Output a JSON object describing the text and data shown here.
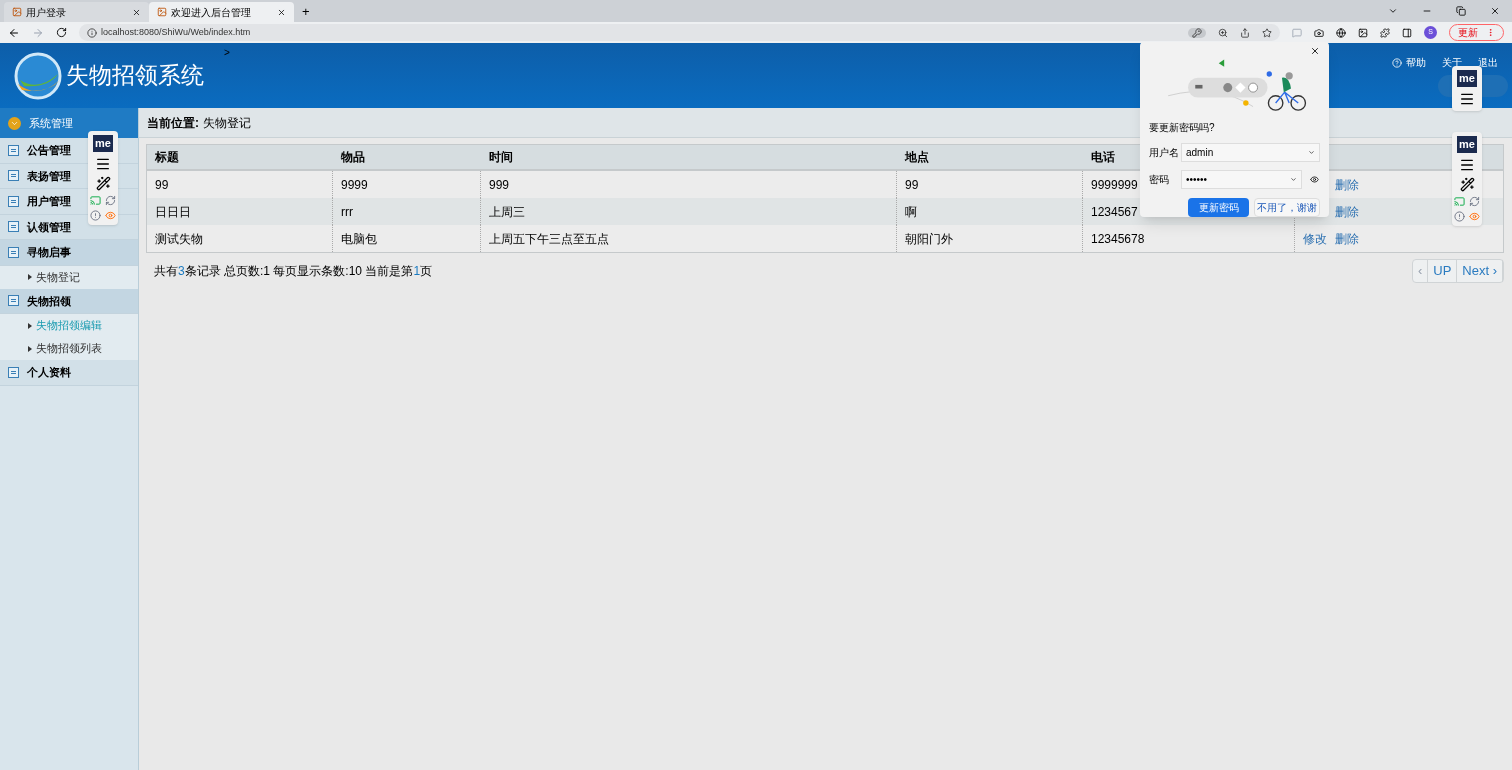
{
  "browser": {
    "tabs": [
      {
        "title": "用户登录",
        "selected": false
      },
      {
        "title": "欢迎进入后台管理",
        "selected": true
      }
    ],
    "new_tab": "+",
    "address": "localhost:8080/ShiWu/Web/index.htm",
    "profile": "S",
    "update_button": "更新"
  },
  "header": {
    "title": "失物招领系统",
    "marker": ">",
    "links": [
      {
        "label": "帮助",
        "kind": "help"
      },
      {
        "label": "关于",
        "kind": "plain"
      },
      {
        "label": "退出",
        "kind": "plain"
      }
    ]
  },
  "sidebar": {
    "heading": "系统管理",
    "items": [
      {
        "label": "公告管理",
        "expanded": false
      },
      {
        "label": "表扬管理",
        "expanded": false
      },
      {
        "label": "用户管理",
        "expanded": false
      },
      {
        "label": "认领管理",
        "expanded": false
      },
      {
        "label": "寻物启事",
        "expanded": true,
        "children": [
          {
            "label": "失物登记",
            "selected": false
          }
        ]
      },
      {
        "label": "失物招领",
        "expanded": true,
        "children": [
          {
            "label": "失物招领编辑",
            "selected": true
          },
          {
            "label": "失物招领列表",
            "selected": false
          }
        ]
      },
      {
        "label": "个人资料",
        "expanded": false
      }
    ]
  },
  "breadcrumb": {
    "label": "当前位置:",
    "value": "失物登记"
  },
  "table": {
    "columns": [
      "标题",
      "物品",
      "时间",
      "地点",
      "电话"
    ],
    "rows": [
      {
        "cells": [
          "99",
          "9999",
          "999",
          "99",
          "9999999"
        ],
        "actions": [
          {
            "label": "删除",
            "kind": "delete"
          }
        ]
      },
      {
        "cells": [
          "日日日",
          "rrr",
          "上周三",
          "啊",
          "1234567"
        ],
        "actions": [
          {
            "label": "删除",
            "kind": "delete"
          }
        ]
      },
      {
        "cells": [
          "测试失物",
          "电脑包",
          "上周五下午三点至五点",
          "朝阳门外",
          "12345678"
        ],
        "actions": [
          {
            "label": "修改",
            "kind": "edit"
          },
          {
            "label": "删除",
            "kind": "delete"
          }
        ]
      }
    ]
  },
  "summary": [
    {
      "text": "共有",
      "highlight": false
    },
    {
      "text": "3",
      "highlight": true
    },
    {
      "text": "条记录 总页数:1 每页显示条数:10 当前是第",
      "highlight": false
    },
    {
      "text": "1",
      "highlight": true
    },
    {
      "text": "页",
      "highlight": false
    }
  ],
  "pager": [
    {
      "label": "‹",
      "disabled": true
    },
    {
      "label": "UP",
      "disabled": false
    },
    {
      "label": "Next ›",
      "disabled": false
    }
  ],
  "password_popup": {
    "title": "要更新密码吗?",
    "username": {
      "label": "用户名",
      "value": "admin"
    },
    "password": {
      "label": "密码",
      "value": "••••••"
    },
    "buttons": [
      {
        "label": "更新密码",
        "kind": "primary"
      },
      {
        "label": "不用了，谢谢",
        "kind": "secondary"
      }
    ]
  },
  "extension_toolbars": [
    {
      "logo": "me",
      "kind": "full"
    },
    {
      "logo": "me",
      "kind": "compact"
    },
    {
      "logo": "me",
      "kind": "full"
    }
  ]
}
